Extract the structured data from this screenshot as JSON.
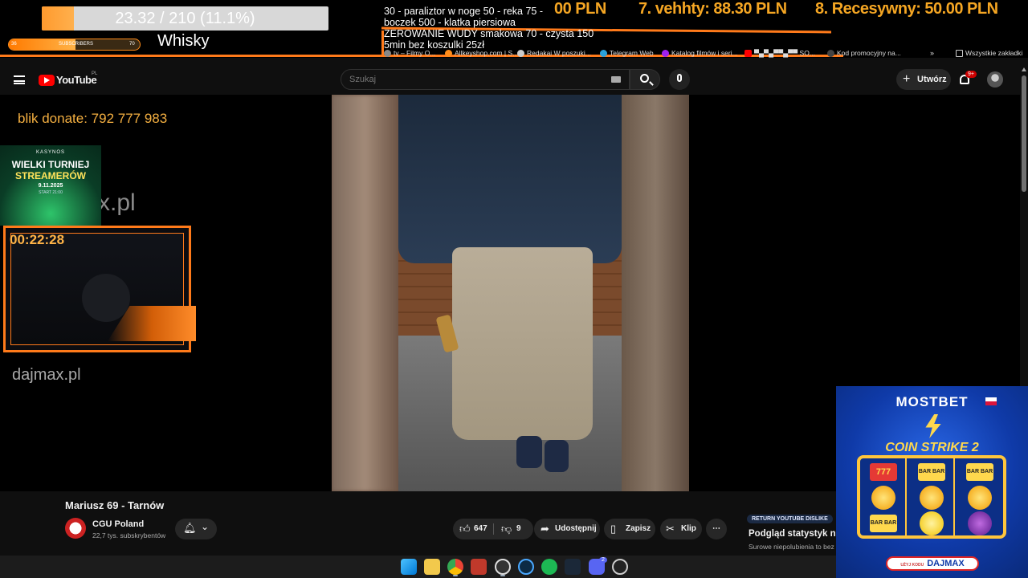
{
  "overlay": {
    "goal_text": "23.32 / 210 (11.1%)",
    "goal_progress": 0.111,
    "sub_goal": {
      "left": "36",
      "label": "SUBSCRIBERS",
      "right": "70",
      "progress": 0.51
    },
    "whisky": "Whisky",
    "rules": [
      "30 - paraliztor w noge 50 - reka 75 -",
      " boczek 500 - klatka piersiowa",
      "ZEROWANIE WUDY smakowa 70 - czysta 150",
      "5min bez koszulki 25zł"
    ],
    "ticker": [
      "00 PLN",
      "7. vehhty: 88.30 PLN",
      "8. Recesywny: 50.00 PLN"
    ],
    "colors": {
      "accent": "#ff7a1a",
      "ticker": "#f5a623"
    }
  },
  "bookmarks": [
    {
      "label": "tv – Filmy O...",
      "icon": "film-icon",
      "color": "#888888"
    },
    {
      "label": "Allkeyshop.com | S...",
      "icon": "allkeyshop-icon",
      "color": "#ff8c1a"
    },
    {
      "label": "Redakai W poszuki...",
      "icon": "redakai-icon",
      "color": "#cccccc"
    },
    {
      "label": "Telegram Web",
      "icon": "telegram-icon",
      "color": "#2aa1da"
    },
    {
      "label": "Katalog filmów i seri...",
      "icon": "catalog-icon",
      "color": "#a020f0"
    },
    {
      "label": "▀▄▀▄▀▀▄▀▀ SO...",
      "icon": "youtube-small-icon",
      "color": "#ff0000"
    },
    {
      "label": "Kod promocyjny na...",
      "icon": "promo-icon",
      "color": "#444444"
    },
    {
      "label": "Wszystkie zakładki",
      "icon": "folder-icon",
      "color": "#cccccc"
    }
  ],
  "youtube": {
    "logo_text": "YouTube",
    "region": "PL",
    "search_placeholder": "Szukaj",
    "create_label": "Utwórz",
    "notifications_badge": "9+"
  },
  "left_overlays": {
    "blik": "blik donate: 792 777 983",
    "casino": {
      "brand": "KASYNOS",
      "line1": "WIELKI TURNIEJ",
      "line2": "STREAMERÓW",
      "date": "9.11.2025",
      "time": "START 21:00"
    },
    "watermark_partial": "x.pl",
    "timer": "00:22:28",
    "site": "dajmax.pl"
  },
  "ad": {
    "brand": "MOSTBET",
    "game": "COIN STRIKE 2",
    "cta_small": "UŻYJ KODU",
    "cta_code": "DAJMAX",
    "reel_symbols": [
      "777",
      "BAR BAR",
      "BAR BAR",
      "BAR BAR"
    ]
  },
  "video": {
    "title": "Mariusz 69 - Tarnów",
    "channel": "CGU Poland",
    "subscribers": "22,7 tys. subskrybentów",
    "likes": "647",
    "dislikes": "9",
    "share": "Udostępnij",
    "save": "Zapisz",
    "clip": "Klip",
    "more": "⋯"
  },
  "ryd": {
    "badge": "RETURN YOUTUBE DISLIKE",
    "title": "Podgląd statystyk ni",
    "subtitle": "Surowe niepolubienia to bez"
  },
  "taskbar": {
    "icons": [
      "windows-start-icon",
      "file-explorer-icon",
      "chrome-icon",
      "record-app-icon",
      "obs-icon",
      "edge-icon",
      "spotify-icon",
      "steam-icon",
      "discord-icon",
      "gog-icon"
    ],
    "discord_badge": "2"
  }
}
